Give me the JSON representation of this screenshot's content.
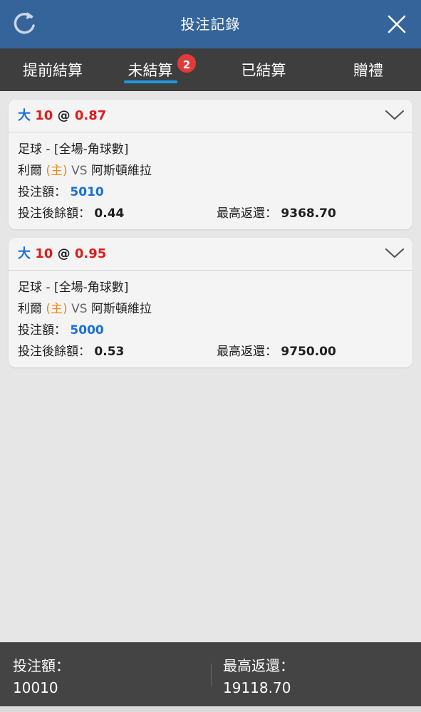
{
  "header": {
    "title": "投注記錄",
    "refresh_icon": "refresh-icon",
    "close_icon": "close-icon",
    "color": "#346499"
  },
  "tabs": [
    {
      "label": "提前結算",
      "active": false
    },
    {
      "label": "未結算",
      "active": true,
      "badge": "2"
    },
    {
      "label": "已結算",
      "active": false
    },
    {
      "label": "贈禮",
      "active": false
    }
  ],
  "bets": [
    {
      "selection": "大",
      "line": "10",
      "at": "@",
      "odds": "0.87",
      "market": "足球 - [全場-角球數]",
      "home": "利爾",
      "home_tag": "(主)",
      "vs": "VS",
      "away": "阿斯頓維拉",
      "stake_label": "投注額：",
      "stake": "5010",
      "balance_label": "投注後餘額：",
      "balance": "0.44",
      "max_return_label": "最高返還：",
      "max_return": "9368.70"
    },
    {
      "selection": "大",
      "line": "10",
      "at": "@",
      "odds": "0.95",
      "market": "足球 - [全場-角球數]",
      "home": "利爾",
      "home_tag": "(主)",
      "vs": "VS",
      "away": "阿斯頓維拉",
      "stake_label": "投注額：",
      "stake": "5000",
      "balance_label": "投注後餘額：",
      "balance": "0.53",
      "max_return_label": "最高返還：",
      "max_return": "9750.00"
    }
  ],
  "footer": {
    "stake_label": "投注額：",
    "stake_total": "10010",
    "return_label": "最高返還：",
    "return_total": "19118.70"
  },
  "colors": {
    "accent_blue": "#1a6fd8",
    "odds_red": "#e01b1b",
    "home_orange": "#e38b1c",
    "tab_underline": "#1e9be0",
    "badge_red": "#e23a3a"
  }
}
